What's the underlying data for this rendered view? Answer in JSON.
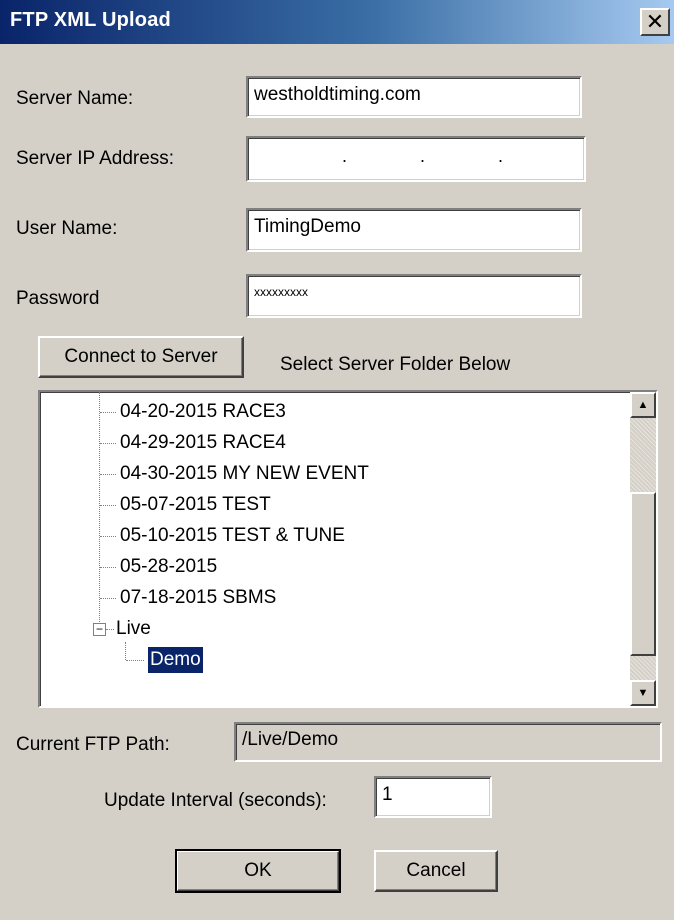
{
  "window": {
    "title": "FTP XML Upload",
    "close_glyph": "✕"
  },
  "form": {
    "server_name_label": "Server Name:",
    "server_name_value": "westholdtiming.com",
    "server_ip_label": "Server IP Address:",
    "server_ip_value": ". . .",
    "user_name_label": "User Name:",
    "user_name_value": "TimingDemo",
    "password_label": "Password",
    "password_value": "xxxxxxxxx"
  },
  "connect": {
    "button_label": "Connect to Server",
    "hint": "Select Server Folder Below"
  },
  "tree": {
    "items": [
      "04-20-2015 RACE3",
      "04-29-2015 RACE4",
      "04-30-2015 MY NEW EVENT",
      "05-07-2015 TEST",
      "05-10-2015 TEST & TUNE",
      "05-28-2015",
      "07-18-2015 SBMS"
    ],
    "live_folder": "Live",
    "live_expander": "−",
    "selected_child": "Demo"
  },
  "path": {
    "label": "Current FTP Path:",
    "value": "/Live/Demo"
  },
  "interval": {
    "label": "Update Interval (seconds):",
    "value": "1"
  },
  "buttons": {
    "ok": "OK",
    "cancel": "Cancel"
  },
  "icons": {
    "scroll_up": "triangle-up-icon",
    "scroll_down": "triangle-down-icon",
    "close": "close-icon"
  }
}
